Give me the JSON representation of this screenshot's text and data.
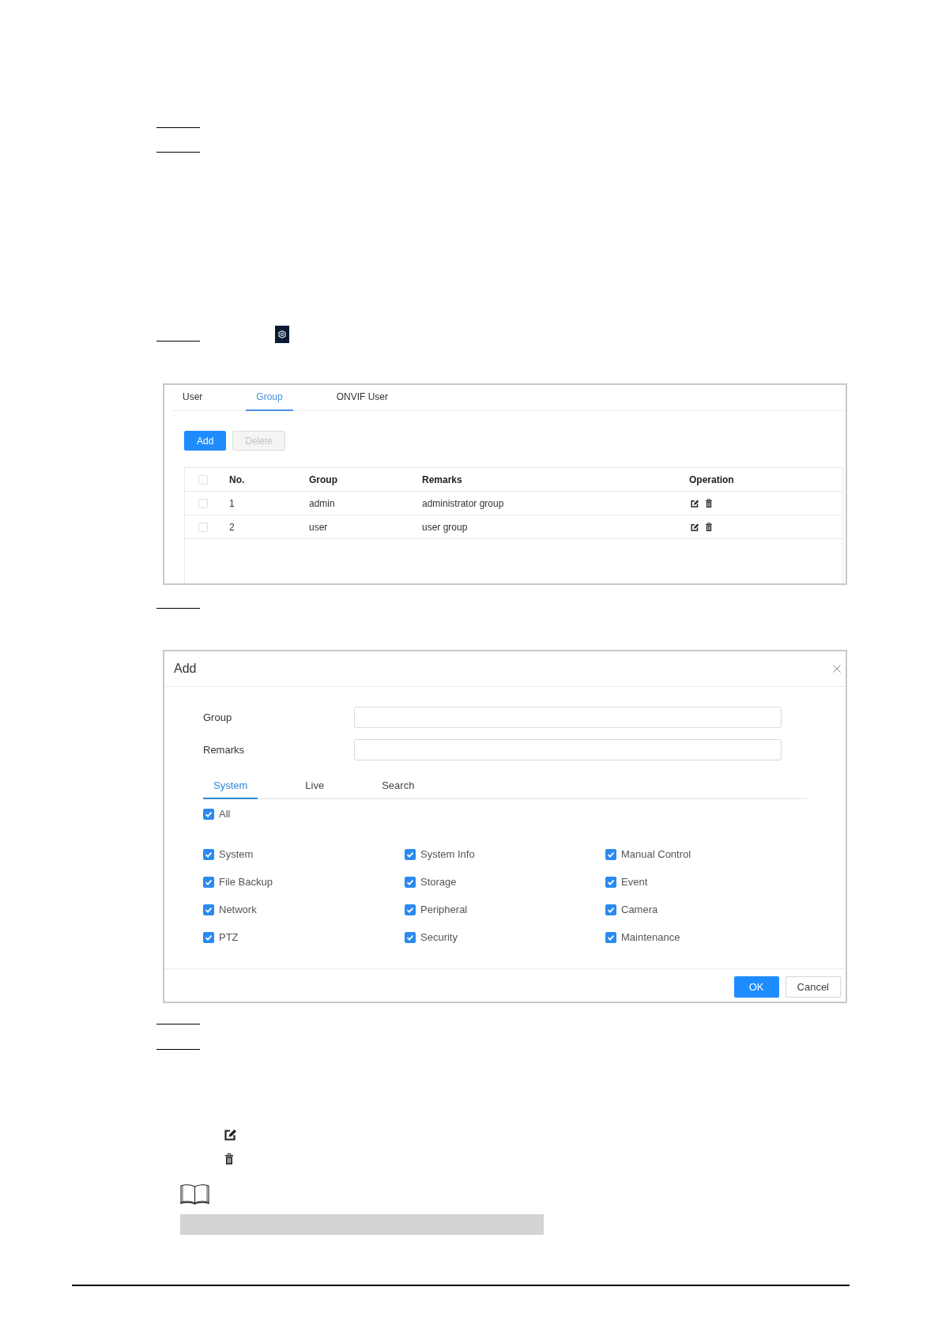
{
  "group_screen": {
    "tabs": [
      {
        "label": "User",
        "selected": false
      },
      {
        "label": "Group",
        "selected": true
      },
      {
        "label": "ONVIF User",
        "selected": false
      }
    ],
    "buttons": [
      {
        "label": "Add",
        "kind": "primary",
        "disabled": false
      },
      {
        "label": "Delete",
        "kind": "default",
        "disabled": true
      }
    ],
    "table": {
      "select_all": {
        "checked": false
      },
      "columns": [
        "No.",
        "Group",
        "Remarks",
        "Operation"
      ],
      "rows": [
        {
          "checked": false,
          "cells": [
            "1",
            "admin",
            "administrator group"
          ]
        },
        {
          "checked": false,
          "cells": [
            "2",
            "user",
            "user group"
          ]
        }
      ]
    }
  },
  "add_dialog": {
    "title": "Add",
    "fields": [
      {
        "label": "Group"
      },
      {
        "label": "Remarks"
      }
    ],
    "tabs": [
      {
        "label": "System",
        "selected": true
      },
      {
        "label": "Live",
        "selected": false
      },
      {
        "label": "Search",
        "selected": false
      }
    ],
    "select_all": {
      "label": "All",
      "checked": true
    },
    "permissions": [
      {
        "label": "System",
        "checked": true
      },
      {
        "label": "System Info",
        "checked": true
      },
      {
        "label": "Manual Control",
        "checked": true
      },
      {
        "label": "File Backup",
        "checked": true
      },
      {
        "label": "Storage",
        "checked": true
      },
      {
        "label": "Event",
        "checked": true
      },
      {
        "label": "Network",
        "checked": true
      },
      {
        "label": "Peripheral",
        "checked": true
      },
      {
        "label": "Camera",
        "checked": true
      },
      {
        "label": "PTZ",
        "checked": true
      },
      {
        "label": "Security",
        "checked": true
      },
      {
        "label": "Maintenance",
        "checked": true
      }
    ],
    "buttons": [
      {
        "label": "OK",
        "kind": "primary"
      },
      {
        "label": "Cancel",
        "kind": "default"
      }
    ]
  }
}
